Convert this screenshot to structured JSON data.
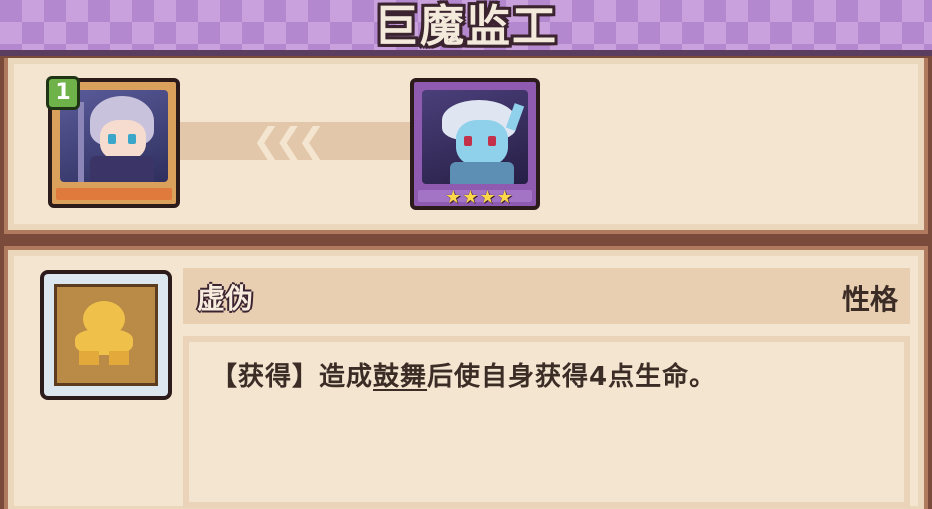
{
  "title": "巨魔监工",
  "evolution": {
    "from": {
      "level": "1"
    },
    "to": {
      "stars": 4
    }
  },
  "skill": {
    "name": "虚伪",
    "type": "性格",
    "description": {
      "prefix": "【获得】造成",
      "keyword": "鼓舞",
      "suffix": "后使自身获得4点生命。"
    }
  },
  "colors": {
    "banner": "#b488cf",
    "panel": "#f3e5d0",
    "frame": "#7a4a3a"
  }
}
